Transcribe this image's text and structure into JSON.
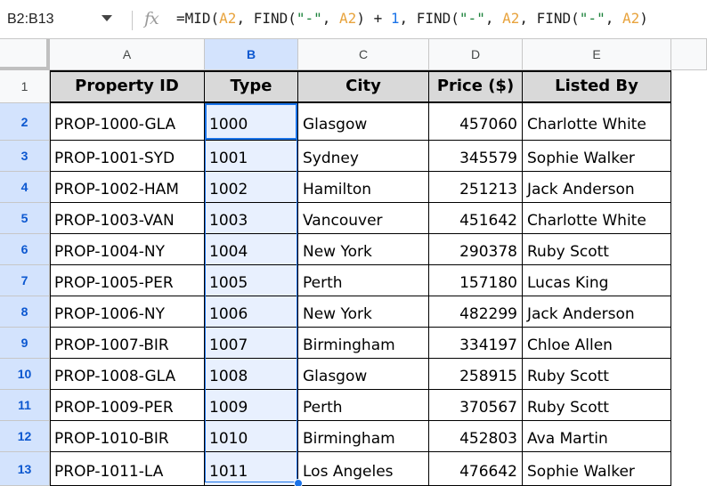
{
  "formula_bar": {
    "name_box": "B2:B13",
    "fx_label": "fx",
    "formula_tokens": [
      {
        "t": "=MID(",
        "k": "plain"
      },
      {
        "t": "A2",
        "k": "ref"
      },
      {
        "t": ", FIND(",
        "k": "plain"
      },
      {
        "t": "\"-\"",
        "k": "str"
      },
      {
        "t": ", ",
        "k": "plain"
      },
      {
        "t": "A2",
        "k": "ref"
      },
      {
        "t": ") + ",
        "k": "plain"
      },
      {
        "t": "1",
        "k": "num"
      },
      {
        "t": ", FIND(",
        "k": "plain"
      },
      {
        "t": "\"-\"",
        "k": "str"
      },
      {
        "t": ", ",
        "k": "plain"
      },
      {
        "t": "A2",
        "k": "ref"
      },
      {
        "t": ", FIND(",
        "k": "plain"
      },
      {
        "t": "\"-\"",
        "k": "str"
      },
      {
        "t": ", ",
        "k": "plain"
      },
      {
        "t": "A2",
        "k": "ref"
      },
      {
        "t": ")",
        "k": "plain"
      }
    ]
  },
  "grid": {
    "column_letters": [
      "A",
      "B",
      "C",
      "D",
      "E"
    ],
    "selected_column": "B",
    "row_numbers": [
      "1",
      "2",
      "3",
      "4",
      "5",
      "6",
      "7",
      "8",
      "9",
      "10",
      "11",
      "12",
      "13"
    ],
    "selected_rows": [
      "2",
      "3",
      "4",
      "5",
      "6",
      "7",
      "8",
      "9",
      "10",
      "11",
      "12",
      "13"
    ],
    "headers": [
      "Property ID",
      "Type",
      "City",
      "Price ($)",
      "Listed By"
    ],
    "rows": [
      [
        "PROP-1000-GLA",
        "1000",
        "Glasgow",
        "457060",
        "Charlotte White"
      ],
      [
        "PROP-1001-SYD",
        "1001",
        "Sydney",
        "345579",
        "Sophie Walker"
      ],
      [
        "PROP-1002-HAM",
        "1002",
        "Hamilton",
        "251213",
        "Jack Anderson"
      ],
      [
        "PROP-1003-VAN",
        "1003",
        "Vancouver",
        "451642",
        "Charlotte White"
      ],
      [
        "PROP-1004-NY",
        "1004",
        "New York",
        "290378",
        "Ruby Scott"
      ],
      [
        "PROP-1005-PER",
        "1005",
        "Perth",
        "157180",
        "Lucas King"
      ],
      [
        "PROP-1006-NY",
        "1006",
        "New York",
        "482299",
        "Jack Anderson"
      ],
      [
        "PROP-1007-BIR",
        "1007",
        "Birmingham",
        "334197",
        "Chloe Allen"
      ],
      [
        "PROP-1008-GLA",
        "1008",
        "Glasgow",
        "258915",
        "Ruby Scott"
      ],
      [
        "PROP-1009-PER",
        "1009",
        "Perth",
        "370567",
        "Ruby Scott"
      ],
      [
        "PROP-1010-BIR",
        "1010",
        "Birmingham",
        "452803",
        "Ava Martin"
      ],
      [
        "PROP-1011-LA",
        "1011",
        "Los Angeles",
        "476642",
        "Sophie Walker"
      ]
    ]
  },
  "colors": {
    "selection_blue": "#1a73e8",
    "header_fill": "#d9d9d9",
    "selected_header_fill": "#d3e3fd"
  }
}
